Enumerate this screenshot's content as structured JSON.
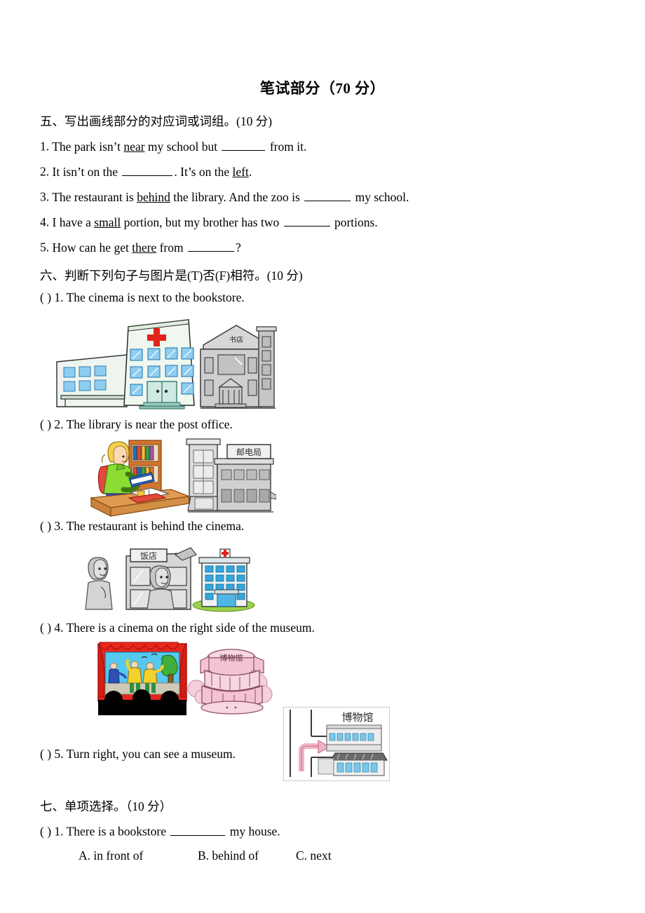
{
  "document": {
    "title": "笔试部分（70 分）"
  },
  "sections": [
    {
      "heading": "五、写出画线部分的对应词或词组。(10 分)",
      "questions": [
        {
          "num": "1.",
          "parts": [
            {
              "t": "The park isn’t ",
              "u": false
            },
            {
              "t": "near",
              "u": true
            },
            {
              "t": " my school but ",
              "u": false
            },
            {
              "t": "__blank60__",
              "u": false
            },
            {
              "t": " from it.",
              "u": false
            }
          ]
        },
        {
          "num": "2.",
          "parts": [
            {
              "t": "It isn’t on the ",
              "u": false
            },
            {
              "t": "__blank70__",
              "u": false
            },
            {
              "t": ". It’s on the ",
              "u": false
            },
            {
              "t": "left",
              "u": true
            },
            {
              "t": ".",
              "u": false
            }
          ]
        },
        {
          "num": "3.",
          "parts": [
            {
              "t": "The restaurant is ",
              "u": false
            },
            {
              "t": "behind",
              "u": true
            },
            {
              "t": " the library. And the zoo is ",
              "u": false
            },
            {
              "t": "__blank65__",
              "u": false
            },
            {
              "t": " my school.",
              "u": false
            }
          ]
        },
        {
          "num": "4.",
          "parts": [
            {
              "t": "I have a ",
              "u": false
            },
            {
              "t": "small",
              "u": true
            },
            {
              "t": " portion, but my brother has two ",
              "u": false
            },
            {
              "t": "__blank65__",
              "u": false
            },
            {
              "t": " portions.",
              "u": false
            }
          ]
        },
        {
          "num": "5.",
          "parts": [
            {
              "t": "How can he get ",
              "u": false
            },
            {
              "t": "there",
              "u": true
            },
            {
              "t": " from ",
              "u": false
            },
            {
              "t": "__blank65__",
              "u": false
            },
            {
              "t": "?",
              "u": false
            }
          ]
        }
      ]
    },
    {
      "heading": "六、判断下列句子与图片是(T)否(F)相符。(10 分)",
      "questions": [
        {
          "bracket": "(      )",
          "num": "1.",
          "text": "The cinema is next to the bookstore."
        },
        {
          "bracket": "(      )",
          "num": "2.",
          "text": "The library is near the post office."
        },
        {
          "bracket": "(      )",
          "num": "3.",
          "text": "The restaurant is behind the cinema."
        },
        {
          "bracket": "(      )",
          "num": "4.",
          "text": "There is a cinema on the right side of the museum."
        },
        {
          "bracket": "(      )",
          "num": "5.",
          "text": "Turn right, you can see a museum."
        }
      ]
    },
    {
      "heading": "七、单项选择。（10 分）",
      "questions": [
        {
          "bracket": "(      )",
          "num": "1.",
          "pre": "There is a bookstore ",
          "post": " my house.",
          "options": [
            "A. in front of",
            "B. behind of",
            "C. next"
          ]
        }
      ]
    }
  ],
  "figures": {
    "fig1": {
      "name": "hospital-and-bookstore",
      "labels": {
        "bookstore_sign": "书店"
      },
      "colors": {
        "cross": "#e2231a",
        "window": "#6cc4ef",
        "building": "#eef5ee",
        "outline": "#2b2b2b",
        "grey": "#c9c9c9"
      }
    },
    "fig2": {
      "name": "library-girl-and-post-office",
      "labels": {
        "post_office_sign": "邮电局"
      },
      "colors": {
        "sweater": "#8ddc33",
        "backpack": "#e8473f",
        "hair": "#f3d14a",
        "desk": "#e09a50",
        "shelf": "#d2762e",
        "building": "#dcdcdc",
        "book": "#2f6fd0"
      }
    },
    "fig3": {
      "name": "restaurant-and-hospital",
      "labels": {
        "restaurant_sign": "饭店"
      },
      "colors": {
        "cross": "#e2231a",
        "window": "#33a6dd",
        "grass": "#9ad24a",
        "grey": "#b7b7b7"
      }
    },
    "fig4": {
      "name": "cinema-theater-and-museum",
      "labels": {
        "museum_sign": "博物馆"
      },
      "colors": {
        "curtain": "#e8261c",
        "sky": "#55c9ef",
        "costume": "#f2d12b",
        "pants": "#2f8f3e",
        "tree": "#3fae3a",
        "audience": "#000000",
        "museum": "#f3c3d3"
      }
    },
    "fig5": {
      "name": "map-turn-right-to-museum",
      "labels": {
        "museum_sign": "博物馆"
      },
      "colors": {
        "arrow": "#efb3c4",
        "road": "#3a3a3a",
        "window": "#79c8ea",
        "grey": "#bfbfbf"
      }
    }
  }
}
